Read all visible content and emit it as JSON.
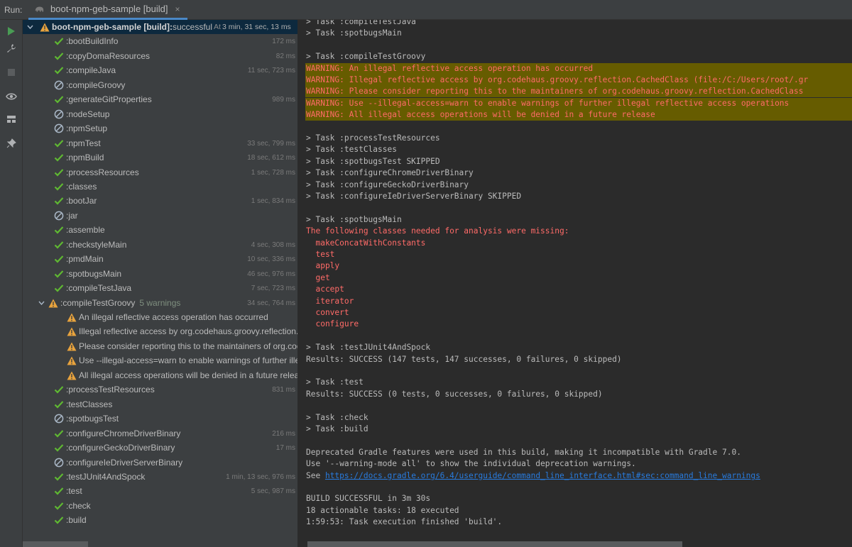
{
  "header": {
    "run_label": "Run:",
    "tab_label": "boot-npm-geb-sample [build]",
    "close_glyph": "×"
  },
  "toolbar": [
    "run-icon",
    "wrench-icon",
    "stop-icon",
    "eye-icon",
    "layout-icon",
    "pin-icon"
  ],
  "tree": {
    "root": {
      "name": "boot-npm-geb-sample [build]:",
      "status": " successful",
      "time_prefix": "At",
      "time": "3 min, 31 sec, 13 ms"
    },
    "items": [
      {
        "icon": "check",
        "name": ":bootBuildInfo",
        "time": "172 ms"
      },
      {
        "icon": "check",
        "name": ":copyDomaResources",
        "time": "82 ms"
      },
      {
        "icon": "check",
        "name": ":compileJava",
        "time": "11 sec, 723 ms"
      },
      {
        "icon": "skip",
        "name": ":compileGroovy",
        "time": ""
      },
      {
        "icon": "check",
        "name": ":generateGitProperties",
        "time": "989 ms"
      },
      {
        "icon": "skip",
        "name": ":nodeSetup",
        "time": ""
      },
      {
        "icon": "skip",
        "name": ":npmSetup",
        "time": ""
      },
      {
        "icon": "check",
        "name": ":npmTest",
        "time": "33 sec, 799 ms"
      },
      {
        "icon": "check",
        "name": ":npmBuild",
        "time": "18 sec, 612 ms"
      },
      {
        "icon": "check",
        "name": ":processResources",
        "time": "1 sec, 728 ms"
      },
      {
        "icon": "check",
        "name": ":classes",
        "time": ""
      },
      {
        "icon": "check",
        "name": ":bootJar",
        "time": "1 sec, 834 ms"
      },
      {
        "icon": "skip",
        "name": ":jar",
        "time": ""
      },
      {
        "icon": "check",
        "name": ":assemble",
        "time": ""
      },
      {
        "icon": "check",
        "name": ":checkstyleMain",
        "time": "4 sec, 308 ms"
      },
      {
        "icon": "check",
        "name": ":pmdMain",
        "time": "10 sec, 336 ms"
      },
      {
        "icon": "check",
        "name": ":spotbugsMain",
        "time": "46 sec, 976 ms"
      },
      {
        "icon": "check",
        "name": ":compileTestJava",
        "time": "7 sec, 723 ms"
      },
      {
        "icon": "warn",
        "name": ":compileTestGroovy",
        "warnings": "5 warnings",
        "time": "34 sec, 764 ms",
        "expanded": true
      },
      {
        "icon": "warn-child",
        "name": "An illegal reflective access operation has occurred",
        "time": ""
      },
      {
        "icon": "warn-child",
        "name": "Illegal reflective access by org.codehaus.groovy.reflection.CachedClass",
        "time": ""
      },
      {
        "icon": "warn-child",
        "name": "Please consider reporting this to the maintainers of org.codehaus.groovy",
        "time": ""
      },
      {
        "icon": "warn-child",
        "name": "Use --illegal-access=warn to enable warnings of further illegal reflective",
        "time": ""
      },
      {
        "icon": "warn-child",
        "name": "All illegal access operations will be denied in a future release",
        "time": ""
      },
      {
        "icon": "check",
        "name": ":processTestResources",
        "time": "831 ms"
      },
      {
        "icon": "check",
        "name": ":testClasses",
        "time": ""
      },
      {
        "icon": "skip",
        "name": ":spotbugsTest",
        "time": ""
      },
      {
        "icon": "check",
        "name": ":configureChromeDriverBinary",
        "time": "216 ms"
      },
      {
        "icon": "check",
        "name": ":configureGeckoDriverBinary",
        "time": "17 ms"
      },
      {
        "icon": "skip",
        "name": ":configureIeDriverServerBinary",
        "time": ""
      },
      {
        "icon": "check",
        "name": ":testJUnit4AndSpock",
        "time": "1 min, 13 sec, 976 ms"
      },
      {
        "icon": "check",
        "name": ":test",
        "time": "5 sec, 987 ms"
      },
      {
        "icon": "check",
        "name": ":check",
        "time": ""
      },
      {
        "icon": "check",
        "name": ":build",
        "time": ""
      }
    ]
  },
  "console": {
    "lines": [
      {
        "t": "normal",
        "text": "> Task :compileTestJava"
      },
      {
        "t": "normal",
        "text": "> Task :spotbugsMain"
      },
      {
        "t": "blank",
        "text": ""
      },
      {
        "t": "normal",
        "text": "> Task :compileTestGroovy"
      },
      {
        "t": "warn",
        "text": "WARNING: An illegal reflective access operation has occurred"
      },
      {
        "t": "warn",
        "text": "WARNING: Illegal reflective access by org.codehaus.groovy.reflection.CachedClass (file:/C:/Users/root/.gr"
      },
      {
        "t": "warn",
        "text": "WARNING: Please consider reporting this to the maintainers of org.codehaus.groovy.reflection.CachedClass"
      },
      {
        "t": "warn",
        "text": "WARNING: Use --illegal-access=warn to enable warnings of further illegal reflective access operations"
      },
      {
        "t": "warn",
        "text": "WARNING: All illegal access operations will be denied in a future release"
      },
      {
        "t": "blank",
        "text": ""
      },
      {
        "t": "normal",
        "text": "> Task :processTestResources"
      },
      {
        "t": "normal",
        "text": "> Task :testClasses"
      },
      {
        "t": "normal",
        "text": "> Task :spotbugsTest SKIPPED"
      },
      {
        "t": "normal",
        "text": "> Task :configureChromeDriverBinary"
      },
      {
        "t": "normal",
        "text": "> Task :configureGeckoDriverBinary"
      },
      {
        "t": "normal",
        "text": "> Task :configureIeDriverServerBinary SKIPPED"
      },
      {
        "t": "blank",
        "text": ""
      },
      {
        "t": "normal",
        "text": "> Task :spotbugsMain"
      },
      {
        "t": "err",
        "text": "The following classes needed for analysis were missing:"
      },
      {
        "t": "err",
        "text": "  makeConcatWithConstants"
      },
      {
        "t": "err",
        "text": "  test"
      },
      {
        "t": "err",
        "text": "  apply"
      },
      {
        "t": "err",
        "text": "  get"
      },
      {
        "t": "err",
        "text": "  accept"
      },
      {
        "t": "err",
        "text": "  iterator"
      },
      {
        "t": "err",
        "text": "  convert"
      },
      {
        "t": "err",
        "text": "  configure"
      },
      {
        "t": "blank",
        "text": ""
      },
      {
        "t": "normal",
        "text": "> Task :testJUnit4AndSpock"
      },
      {
        "t": "normal",
        "text": "Results: SUCCESS (147 tests, 147 successes, 0 failures, 0 skipped)"
      },
      {
        "t": "blank",
        "text": ""
      },
      {
        "t": "normal",
        "text": "> Task :test"
      },
      {
        "t": "normal",
        "text": "Results: SUCCESS (0 tests, 0 successes, 0 failures, 0 skipped)"
      },
      {
        "t": "blank",
        "text": ""
      },
      {
        "t": "normal",
        "text": "> Task :check"
      },
      {
        "t": "normal",
        "text": "> Task :build"
      },
      {
        "t": "blank",
        "text": ""
      },
      {
        "t": "normal",
        "text": "Deprecated Gradle features were used in this build, making it incompatible with Gradle 7.0."
      },
      {
        "t": "normal",
        "text": "Use '--warning-mode all' to show the individual deprecation warnings."
      },
      {
        "t": "link",
        "text": "See ",
        "link": "https://docs.gradle.org/6.4/userguide/command_line_interface.html#sec:command_line_warnings"
      },
      {
        "t": "blank",
        "text": ""
      },
      {
        "t": "normal",
        "text": "BUILD SUCCESSFUL in 3m 30s"
      },
      {
        "t": "normal",
        "text": "18 actionable tasks: 18 executed"
      },
      {
        "t": "normal",
        "text": "1:59:53: Task execution finished 'build'."
      }
    ]
  },
  "colors": {
    "check": "#5fb832",
    "skip": "#a9b7c6",
    "warn": "#e8a33d",
    "run": "#499c54"
  }
}
